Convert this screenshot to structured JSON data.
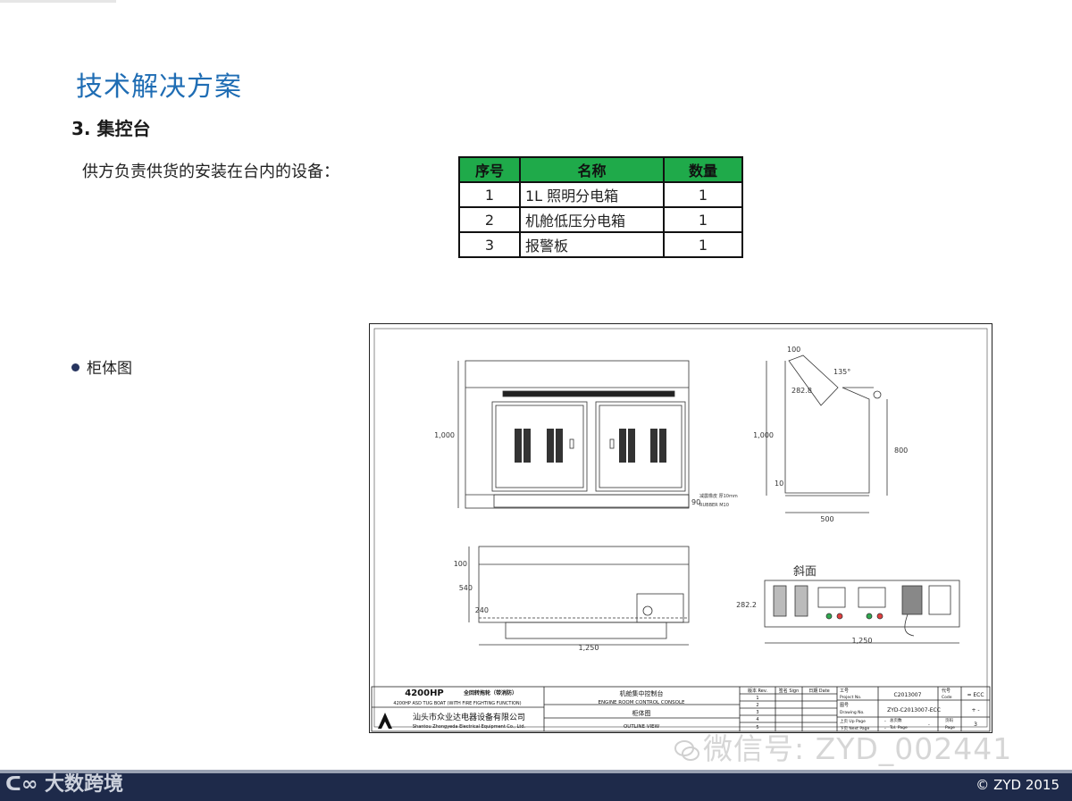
{
  "slide": {
    "title": "技术解决方案",
    "subtitle": "3. 集控台",
    "intro": "供方负责供货的安装在台内的设备：",
    "bullet": "柜体图"
  },
  "table": {
    "headers": [
      "序号",
      "名称",
      "数量"
    ],
    "rows": [
      {
        "no": "1",
        "name": "1L 照明分电箱",
        "qty": "1"
      },
      {
        "no": "2",
        "name": "机舱低压分电箱",
        "qty": "1"
      },
      {
        "no": "3",
        "name": "报警板",
        "qty": "1"
      }
    ],
    "header_color": "#1faa4a"
  },
  "drawing": {
    "front_width": "1,000",
    "dim_90": "90",
    "rubber": "RUBBER M10",
    "rubber_cn": "减震橡皮 厚10mm",
    "side_top": "100",
    "angle": "135°",
    "diag": "282.8",
    "side_height": "1,000",
    "side_right": "800",
    "side_bottom_small": "10",
    "side_depth": "500",
    "plan_top": "100",
    "plan_depth": "540",
    "plan_inner": "240",
    "plan_width": "1,250",
    "slope_label": "斜面",
    "slope_height": "282.2",
    "slope_width": "1,250",
    "tb_boat": "4200HP",
    "tb_boat_cn": "全回转拖轮（带消防）",
    "tb_boat_en": "4200HP ASD TUG BOAT (WITH FIRE FIGHTING FUNCTION)",
    "tb_company_cn": "汕头市众业达电器设备有限公司",
    "tb_company_en": "Shantou Zhongyeda Electrical Equipment Co., Ltd.",
    "tb_name_cn": "机舱集中控制台",
    "tb_name_en": "ENGINE ROOM CONTROL CONSOLE",
    "tb_view_cn": "柜体图",
    "tb_view_en": "OUTLINE VIEW",
    "tb_rev": "版本 Rev.",
    "tb_sign": "签名 Sign",
    "tb_date": "日期 Date",
    "tb_rev_rows": [
      "1",
      "2",
      "3",
      "4",
      "5"
    ],
    "tb_project_label": "工号",
    "tb_project_label_en": "Project No.",
    "tb_project": "C2013007",
    "tb_code_label": "代号",
    "tb_code_label_en": "Code",
    "tb_code": "= ECC",
    "tb_drawing_label": "图号",
    "tb_drawing_label_en": "Drawing No.",
    "tb_drawing": "ZYD-C2013007-ECC",
    "tb_drawing_extra": "+ -",
    "tb_up_label": "上页 Up Page",
    "tb_up": "-",
    "tb_total_label": "总页数",
    "tb_total_label_en": "Tol. Page",
    "tb_total": "-",
    "tb_next_label": "下页 Next Page",
    "tb_next": "-",
    "tb_page_label": "页码",
    "tb_page_label_en": "Page",
    "tb_page": "3"
  },
  "watermark": "微信号: ZYD_002441",
  "footer": {
    "logo": "大数跨境",
    "copyright": "© ZYD 2015"
  }
}
